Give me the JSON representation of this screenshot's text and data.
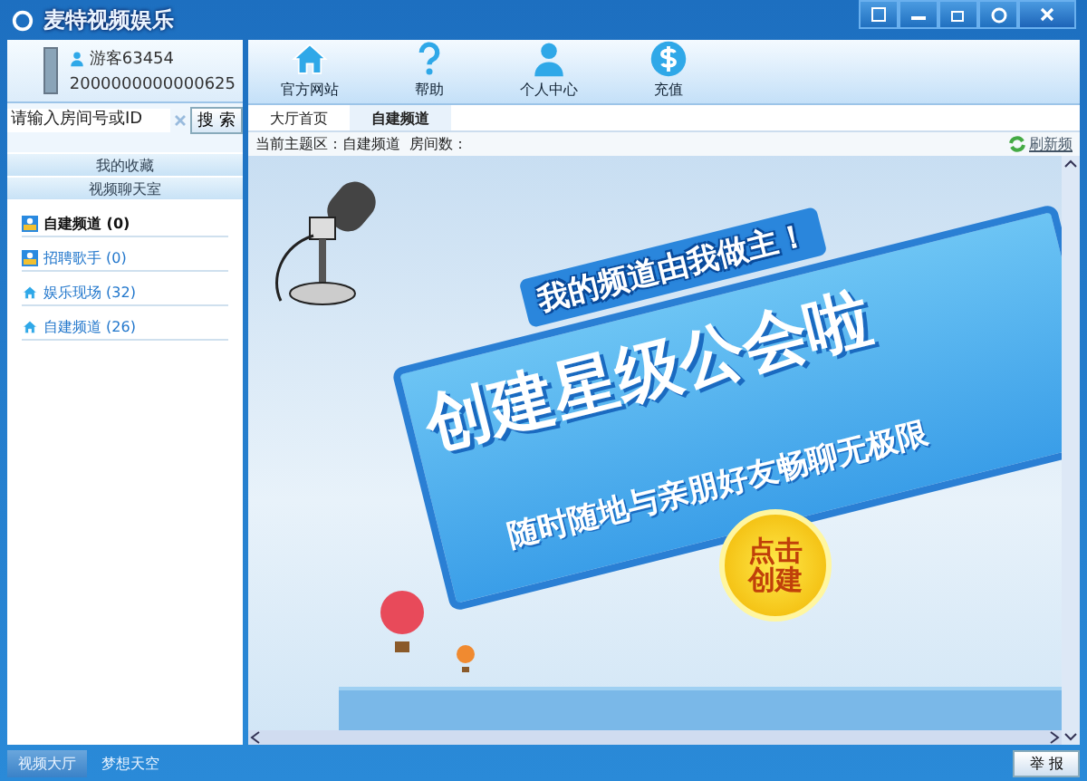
{
  "window": {
    "title": "麦特视频娱乐"
  },
  "user": {
    "name": "游客63454",
    "id": "2000000000000625"
  },
  "search": {
    "placeholder": "请输入房间号或ID",
    "button": "搜 索"
  },
  "sidebar": {
    "sections": [
      "我的收藏",
      "视频聊天室"
    ],
    "rooms": [
      {
        "label": "自建频道 (0)",
        "kind": "user",
        "selected": true
      },
      {
        "label": "招聘歌手 (0)",
        "kind": "user",
        "selected": false
      },
      {
        "label": "娱乐现场 (32)",
        "kind": "home",
        "selected": false
      },
      {
        "label": "自建频道 (26)",
        "kind": "home",
        "selected": false
      }
    ]
  },
  "toolbar": [
    {
      "label": "官方网站",
      "kind": "home"
    },
    {
      "label": "帮助",
      "kind": "help"
    },
    {
      "label": "个人中心",
      "kind": "user"
    },
    {
      "label": "充值",
      "kind": "money"
    }
  ],
  "tabs": [
    {
      "label": "大厅首页",
      "selected": false
    },
    {
      "label": "自建频道",
      "selected": true
    }
  ],
  "info": {
    "text": "当前主题区：自建频道  房间数：",
    "refresh": "刷新频"
  },
  "banner": {
    "headline": "我的频道由我做主！",
    "title": "创建星级公会啦",
    "subtitle": "随时随地与亲朋好友畅聊无极限",
    "button": "点击创建"
  },
  "bottom_tabs": [
    {
      "label": "视频大厅",
      "selected": true
    },
    {
      "label": "梦想天空",
      "selected": false
    }
  ],
  "report_button": "举 报"
}
